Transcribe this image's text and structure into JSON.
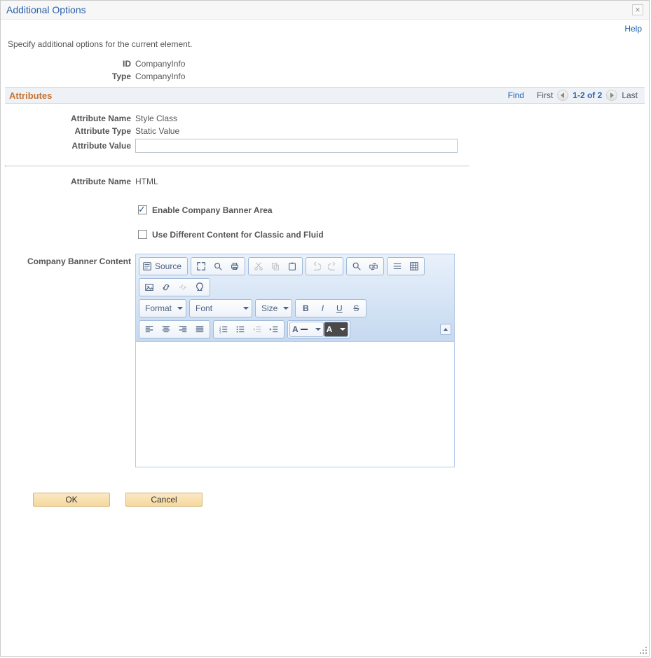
{
  "dialog": {
    "title": "Additional Options"
  },
  "help": {
    "label": "Help"
  },
  "instruction": "Specify additional options for the current element.",
  "header": {
    "id_label": "ID",
    "id_value": "CompanyInfo",
    "type_label": "Type",
    "type_value": "CompanyInfo"
  },
  "attributes_section": {
    "title": "Attributes",
    "find": "Find",
    "first": "First",
    "range": "1-2 of 2",
    "last": "Last"
  },
  "attr1": {
    "name_label": "Attribute Name",
    "name_value": "Style Class",
    "type_label": "Attribute Type",
    "type_value": "Static Value",
    "value_label": "Attribute Value",
    "value_value": ""
  },
  "attr2": {
    "name_label": "Attribute Name",
    "name_value": "HTML",
    "enable_banner": "Enable Company Banner Area",
    "diff_content": "Use Different Content for Classic and Fluid",
    "banner_label": "Company Banner Content"
  },
  "editor": {
    "source": "Source",
    "format": "Format",
    "font": "Font",
    "size": "Size",
    "letterA": "A"
  },
  "actions": {
    "ok": "OK",
    "cancel": "Cancel"
  }
}
